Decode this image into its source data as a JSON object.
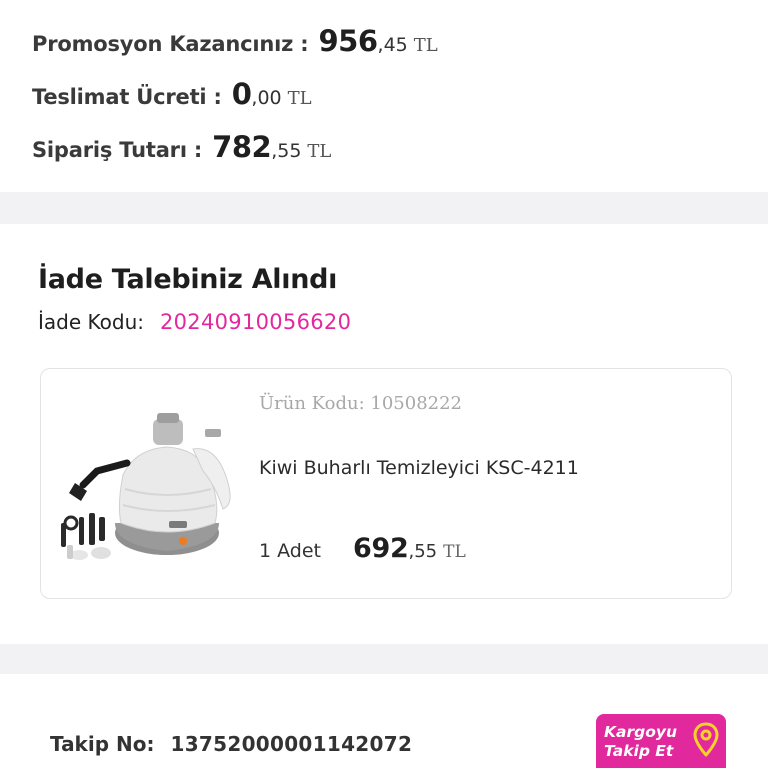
{
  "summary": {
    "promotion": {
      "label": "Promosyon Kazancınız :",
      "int": "956",
      "dec": ",45",
      "currency": "TL"
    },
    "delivery": {
      "label": "Teslimat Ücreti :",
      "int": "0",
      "dec": ",00",
      "currency": "TL"
    },
    "order": {
      "label": "Sipariş Tutarı :",
      "int": "782",
      "dec": ",55",
      "currency": "TL"
    }
  },
  "return_request": {
    "title": "İade Talebiniz Alındı",
    "code_label": "İade Kodu:",
    "code_value": "20240910056620",
    "product": {
      "code_line": "Ürün Kodu: 10508222",
      "name": "Kiwi Buharlı Temizleyici KSC-4211",
      "quantity": "1 Adet",
      "price_int": "692",
      "price_dec": ",55",
      "currency": "TL",
      "image_icon": "steam-cleaner-image"
    }
  },
  "tracking": {
    "label": "Takip No:",
    "value": "13752000001142072",
    "button_line1": "Kargoyu",
    "button_line2": "Takip Et",
    "button_icon": "location-pin-icon"
  },
  "colors": {
    "accent": "#e2289d",
    "pin": "#f5d22a",
    "background": "#f2f2f4",
    "card": "#ffffff"
  }
}
